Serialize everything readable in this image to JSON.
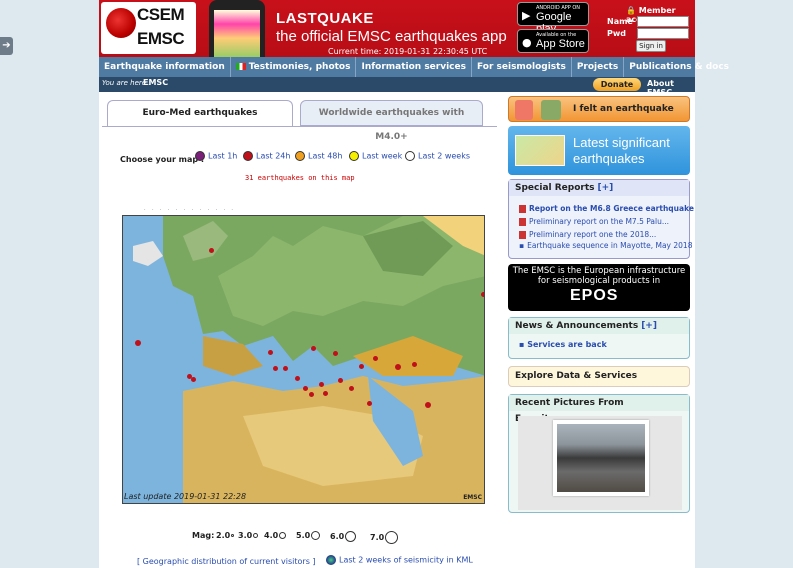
{
  "header": {
    "logo_line1": "CSEM",
    "logo_line2": "EMSC",
    "app_title": "LASTQUAKE",
    "app_subtitle": "the official EMSC earthquakes app",
    "current_time": "Current time: 2019-01-31 22:30:45 UTC",
    "google_play_small": "ANDROID APP ON",
    "google_play_big": "Google play",
    "app_store_small": "Available on the",
    "app_store_big": "App Store",
    "member_access": "Member access",
    "name_label": "Name",
    "pwd_label": "Pwd",
    "sign_in": "Sign in"
  },
  "nav": {
    "items": [
      "Earthquake information",
      "Testimonies, photos",
      "Information services",
      "For seismologists",
      "Projects",
      "Publications & docs"
    ]
  },
  "breadcrumb": {
    "prefix": "You are here :",
    "current": "EMSC",
    "donate": "Donate",
    "about": "About EMSC"
  },
  "tabs": {
    "euromed": "Euro-Med earthquakes",
    "worldwide": "Worldwide earthquakes with M4.0+"
  },
  "map_options": {
    "label": "Choose your map :",
    "options": [
      {
        "label": "Last 1h",
        "color": "#7a1f7a"
      },
      {
        "label": "Last 24h",
        "color": "#c0101a"
      },
      {
        "label": "Last 48h",
        "color": "#f0a020"
      },
      {
        "label": "Last week",
        "color": "#f5f000"
      },
      {
        "label": "Last 2 weeks",
        "color": "#ffffff"
      }
    ],
    "count_text": "31 earthquakes on this map"
  },
  "map": {
    "last_update": "Last update 2019-01-31 22:28",
    "watermark": "EMSC"
  },
  "magnitude": {
    "label": "Mag:",
    "values": [
      "2.0",
      "3.0",
      "4.0",
      "5.0",
      "6.0",
      "7.0"
    ]
  },
  "footer": {
    "visitors_link": "[ Geographic distribution of current visitors ]",
    "kml_link": "Last 2 weeks of seismicity in KML"
  },
  "sidebar": {
    "felt_button": "I felt an earthquake",
    "latest_line1": "Latest significant",
    "latest_line2": "earthquakes",
    "special_reports_title": "Special Reports",
    "plus": "[+]",
    "special_reports": [
      "Report on the M6.8 Greece earthquake",
      "Preliminary report on the M7.5 Palu...",
      "Preliminary report one the 2018...",
      "Earthquake sequence in Mayotte, May 2018"
    ],
    "epos_line1": "The EMSC is the European infrastructure",
    "epos_line2": "for seismological products in",
    "epos_logo": "EPOS",
    "news_title": "News & Announcements",
    "news_link": "Services are back",
    "explore_title": "Explore Data & Services",
    "pictures_title": "Recent Pictures From Eyewitnesses"
  }
}
